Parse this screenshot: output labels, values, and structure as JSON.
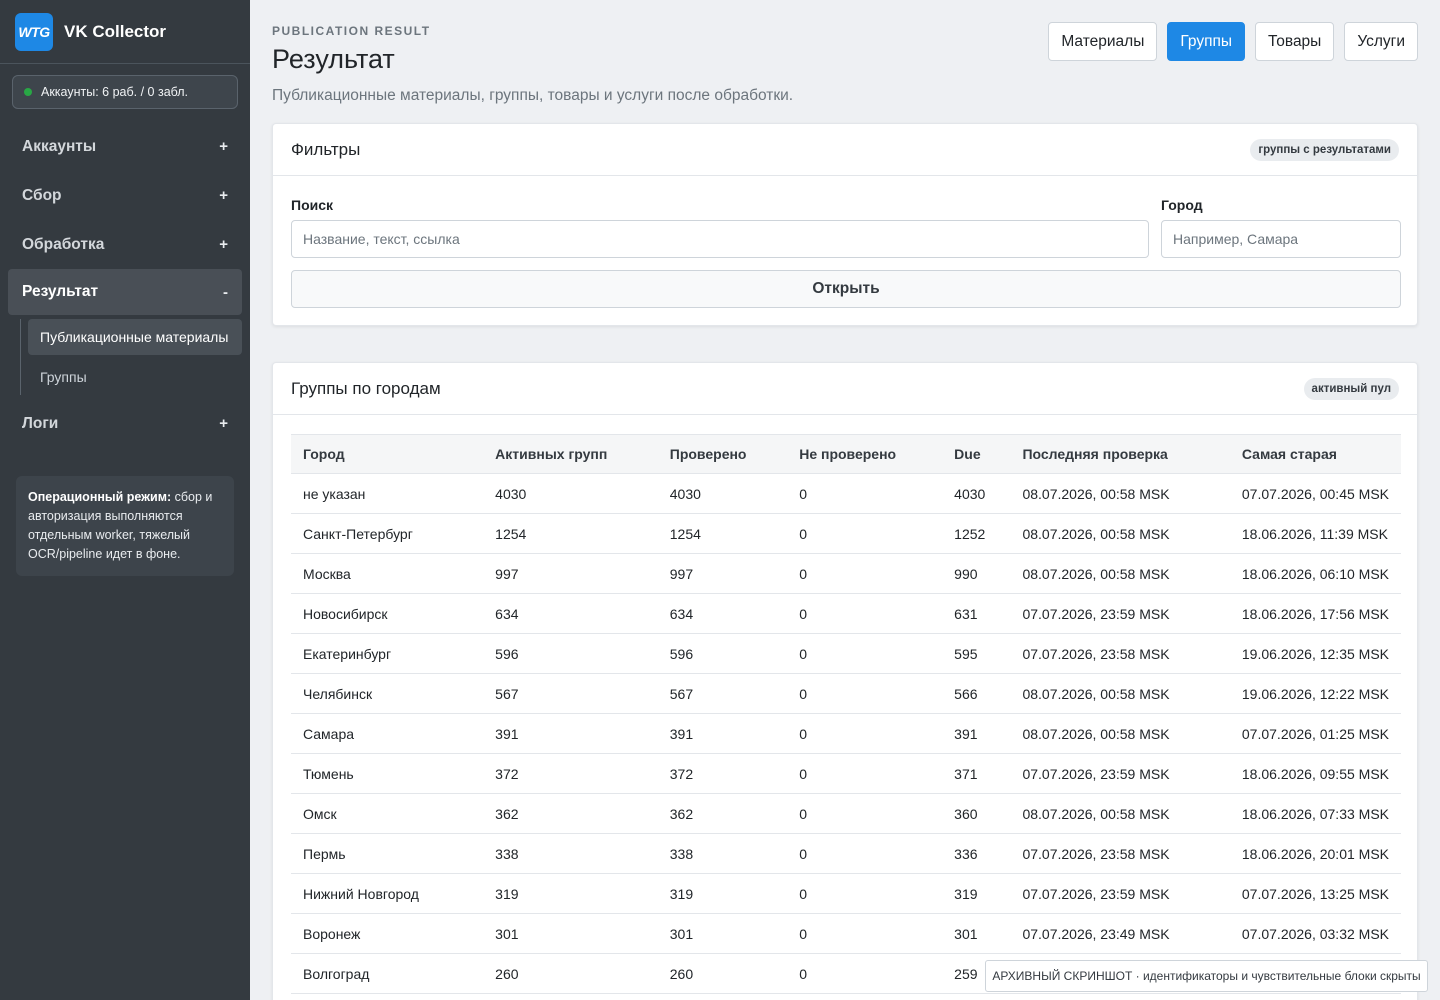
{
  "sidebar": {
    "logo_text": "WTG",
    "app_title": "VK Collector",
    "account_status": "Аккаунты: 6 раб. / 0 забл.",
    "status_color": "#28a745",
    "nav": [
      {
        "label": "Аккаунты",
        "toggle": "+"
      },
      {
        "label": "Сбор",
        "toggle": "+"
      },
      {
        "label": "Обработка",
        "toggle": "+"
      },
      {
        "label": "Результат",
        "toggle": "-"
      },
      {
        "label": "Логи",
        "toggle": "+"
      }
    ],
    "subnav": [
      {
        "label": "Публикационные материалы"
      },
      {
        "label": "Группы"
      }
    ],
    "ops_note_title": "Операционный режим:",
    "ops_note_text": " сбор и авторизация выполняются отдельным worker, тяжелый OCR/pipeline идет в фоне."
  },
  "header": {
    "kicker": "PUBLICATION RESULT",
    "title": "Результат",
    "subtitle": "Публикационные материалы, группы, товары и услуги после обработки.",
    "tabs": [
      {
        "label": "Материалы"
      },
      {
        "label": "Группы"
      },
      {
        "label": "Товары"
      },
      {
        "label": "Услуги"
      }
    ],
    "accent": "#1e88e5"
  },
  "filters": {
    "title": "Фильтры",
    "badge": "группы с результатами",
    "search_label": "Поиск",
    "search_placeholder": "Название, текст, ссылка",
    "search_value": "",
    "city_label": "Город",
    "city_placeholder": "Например, Самара",
    "city_value": "",
    "open_button": "Открыть"
  },
  "groups": {
    "title": "Группы по городам",
    "badge": "активный пул",
    "columns": [
      "Город",
      "Активных групп",
      "Проверено",
      "Не проверено",
      "Due",
      "Последняя проверка",
      "Самая старая"
    ],
    "rows": [
      [
        "не указан",
        "4030",
        "4030",
        "0",
        "4030",
        "08.07.2026, 00:58 MSK",
        "07.07.2026, 00:45 MSK"
      ],
      [
        "Санкт-Петербург",
        "1254",
        "1254",
        "0",
        "1252",
        "08.07.2026, 00:58 MSK",
        "18.06.2026, 11:39 MSK"
      ],
      [
        "Москва",
        "997",
        "997",
        "0",
        "990",
        "08.07.2026, 00:58 MSK",
        "18.06.2026, 06:10 MSK"
      ],
      [
        "Новосибирск",
        "634",
        "634",
        "0",
        "631",
        "07.07.2026, 23:59 MSK",
        "18.06.2026, 17:56 MSK"
      ],
      [
        "Екатеринбург",
        "596",
        "596",
        "0",
        "595",
        "07.07.2026, 23:58 MSK",
        "19.06.2026, 12:35 MSK"
      ],
      [
        "Челябинск",
        "567",
        "567",
        "0",
        "566",
        "08.07.2026, 00:58 MSK",
        "19.06.2026, 12:22 MSK"
      ],
      [
        "Самара",
        "391",
        "391",
        "0",
        "391",
        "08.07.2026, 00:58 MSK",
        "07.07.2026, 01:25 MSK"
      ],
      [
        "Тюмень",
        "372",
        "372",
        "0",
        "371",
        "07.07.2026, 23:59 MSK",
        "18.06.2026, 09:55 MSK"
      ],
      [
        "Омск",
        "362",
        "362",
        "0",
        "360",
        "08.07.2026, 00:58 MSK",
        "18.06.2026, 07:33 MSK"
      ],
      [
        "Пермь",
        "338",
        "338",
        "0",
        "336",
        "07.07.2026, 23:58 MSK",
        "18.06.2026, 20:01 MSK"
      ],
      [
        "Нижний Новгород",
        "319",
        "319",
        "0",
        "319",
        "07.07.2026, 23:59 MSK",
        "07.07.2026, 13:25 MSK"
      ],
      [
        "Воронеж",
        "301",
        "301",
        "0",
        "301",
        "07.07.2026, 23:49 MSK",
        "07.07.2026, 03:32 MSK"
      ],
      [
        "Волгоград",
        "260",
        "260",
        "0",
        "259",
        "",
        ""
      ]
    ]
  },
  "archive_note": "АРХИВНЫЙ СКРИНШОТ · идентификаторы и чувствительные блоки скрыты"
}
